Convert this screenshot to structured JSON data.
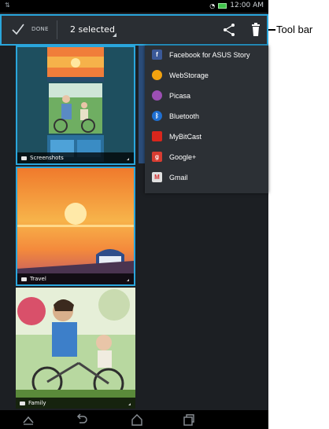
{
  "status_bar": {
    "time": "12:00 AM"
  },
  "toolbar": {
    "done_label": "DONE",
    "selected_label": "2 selected"
  },
  "callout": {
    "label": "Tool bar"
  },
  "albums": [
    {
      "name": "Screenshots",
      "selected": true
    },
    {
      "name": "Travel",
      "selected": true
    },
    {
      "name": "Family",
      "selected": false
    }
  ],
  "share_menu": {
    "items": [
      {
        "label": "Facebook for ASUS Story",
        "icon": "facebook-icon",
        "color": "#3b5998"
      },
      {
        "label": "WebStorage",
        "icon": "webstorage-icon",
        "color": "#f2a20f"
      },
      {
        "label": "Picasa",
        "icon": "picasa-icon",
        "color": "#9c4fb3"
      },
      {
        "label": "Bluetooth",
        "icon": "bluetooth-icon",
        "color": "#1f6fd1"
      },
      {
        "label": "MyBitCast",
        "icon": "mybitcast-icon",
        "color": "#d9261c"
      },
      {
        "label": "Google+",
        "icon": "google-plus-icon",
        "color": "#d73d32"
      },
      {
        "label": "Gmail",
        "icon": "gmail-icon",
        "color": "#e0e0e0"
      }
    ]
  },
  "colors": {
    "accent": "#2aa6dc",
    "toolbar_bg": "#2a2e33",
    "menu_bg": "#2c3035"
  }
}
